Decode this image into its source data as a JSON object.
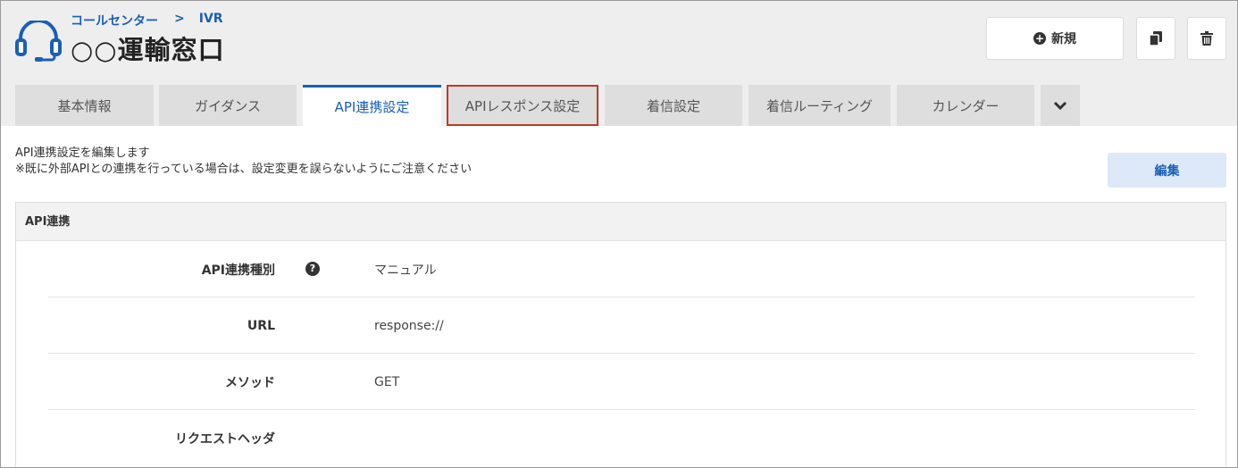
{
  "header": {
    "breadcrumb": [
      "コールセンター",
      ">",
      "IVR"
    ],
    "title": "○○運輸窓口",
    "new_button": "新規"
  },
  "tabs": [
    {
      "label": "基本情報"
    },
    {
      "label": "ガイダンス"
    },
    {
      "label": "API連携設定"
    },
    {
      "label": "APIレスポンス設定"
    },
    {
      "label": "着信設定"
    },
    {
      "label": "着信ルーティング"
    },
    {
      "label": "カレンダー"
    }
  ],
  "content": {
    "description_line1": "API連携設定を編集します",
    "description_line2": "※既に外部APIとの連携を行っている場合は、設定変更を誤らないようにご注意ください",
    "edit_button": "編集",
    "panel_title": "API連携",
    "rows": [
      {
        "label": "API連携種別",
        "value": "マニュアル"
      },
      {
        "label": "URL",
        "value": "response://"
      },
      {
        "label": "メソッド",
        "value": "GET"
      },
      {
        "label": "リクエストヘッダ",
        "value": ""
      }
    ]
  },
  "colors": {
    "accent": "#1a5fb4",
    "highlight_border": "#c0392b",
    "edit_button_bg": "#dde8f8"
  },
  "icons": [
    "headset-icon",
    "plus-circle-icon",
    "copy-icon",
    "trash-icon",
    "chevron-down-icon",
    "question-circle-icon"
  ]
}
